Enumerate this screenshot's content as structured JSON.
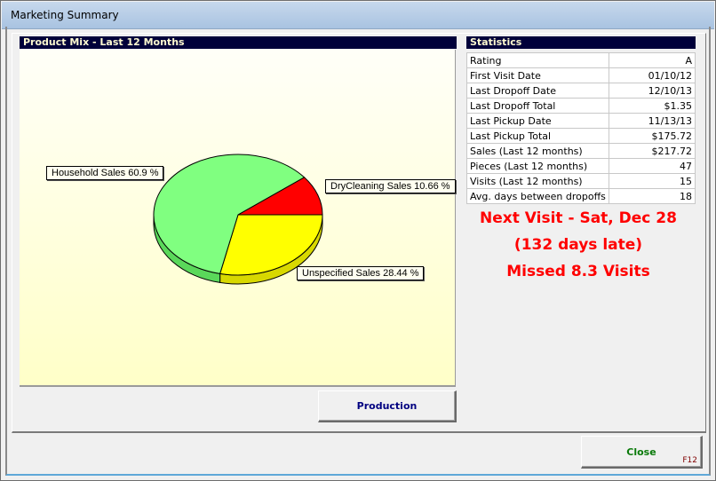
{
  "window": {
    "title": "Marketing Summary"
  },
  "product_mix": {
    "header": "Product Mix - Last 12 Months"
  },
  "statistics": {
    "header": "Statistics",
    "rows": [
      {
        "label": "Rating",
        "value": "A"
      },
      {
        "label": "First Visit Date",
        "value": "01/10/12"
      },
      {
        "label": "Last Dropoff Date",
        "value": "12/10/13"
      },
      {
        "label": "Last Dropoff Total",
        "value": "$1.35"
      },
      {
        "label": "Last Pickup Date",
        "value": "11/13/13"
      },
      {
        "label": "Last Pickup Total",
        "value": "$175.72"
      },
      {
        "label": "Sales (Last 12 months)",
        "value": "$217.72"
      },
      {
        "label": "Pieces (Last 12 months)",
        "value": "47"
      },
      {
        "label": "Visits (Last 12 months)",
        "value": "15"
      },
      {
        "label": "Avg. days between dropoffs",
        "value": "18"
      }
    ]
  },
  "alerts": {
    "next_visit": "Next Visit - Sat, Dec 28",
    "days_late": "(132 days late)",
    "missed": "Missed 8.3 Visits",
    "color": "#ff0000"
  },
  "buttons": {
    "production": "Production",
    "close": "Close",
    "close_shortcut": "F12"
  },
  "chart_data": {
    "type": "pie",
    "title": "Product Mix - Last 12 Months",
    "style": "3d",
    "slices": [
      {
        "name": "DryCleaning Sales",
        "value": 10.66,
        "label": "DryCleaning Sales 10.66 %",
        "color": "#ff0000",
        "side_color": "#c80000"
      },
      {
        "name": "Unspecified Sales",
        "value": 28.44,
        "label": "Unspecified Sales 28.44 %",
        "color": "#ffff00",
        "side_color": "#d8d800"
      },
      {
        "name": "Household Sales",
        "value": 60.9,
        "label": "Household Sales 60.9 %",
        "color": "#80ff80",
        "side_color": "#5ad85a"
      }
    ]
  }
}
